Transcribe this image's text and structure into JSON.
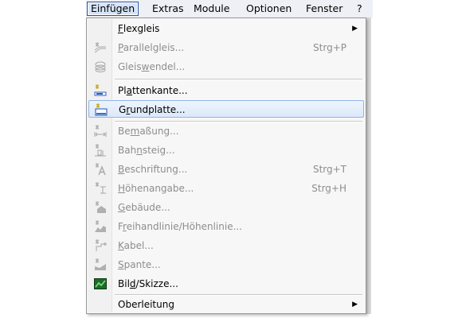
{
  "menubar": {
    "items": [
      {
        "label": "Einfügen",
        "active": true
      },
      {
        "label": "Extras"
      },
      {
        "label": "Module"
      },
      {
        "label": "Optionen"
      },
      {
        "label": "Fenster"
      },
      {
        "label": "?"
      }
    ]
  },
  "menu": {
    "items": [
      {
        "pre": "",
        "u": "F",
        "post": "lexgleis",
        "shortcut": "",
        "submenu": true,
        "enabled": true,
        "icon": "none"
      },
      {
        "pre": "",
        "u": "P",
        "post": "arallelgleis...",
        "shortcut": "Strg+P",
        "enabled": false,
        "icon": "parallel-track-icon"
      },
      {
        "pre": "Gleis",
        "u": "w",
        "post": "endel...",
        "shortcut": "",
        "enabled": false,
        "icon": "helix-icon"
      },
      {
        "pre": "Pl",
        "u": "a",
        "post": "ttenkante...",
        "shortcut": "",
        "enabled": true,
        "icon": "plate-edge-icon"
      },
      {
        "pre": "G",
        "u": "r",
        "post": "undplatte...",
        "shortcut": "",
        "enabled": true,
        "selected": true,
        "icon": "baseplate-icon"
      },
      {
        "pre": "Be",
        "u": "m",
        "post": "aßung...",
        "shortcut": "",
        "enabled": false,
        "icon": "dimension-icon"
      },
      {
        "pre": "Bah",
        "u": "n",
        "post": "steig...",
        "shortcut": "",
        "enabled": false,
        "icon": "platform-icon"
      },
      {
        "pre": "",
        "u": "B",
        "post": "eschriftung...",
        "shortcut": "Strg+T",
        "enabled": false,
        "icon": "text-label-icon"
      },
      {
        "pre": "",
        "u": "H",
        "post": "öhenangabe...",
        "shortcut": "Strg+H",
        "enabled": false,
        "icon": "height-marker-icon"
      },
      {
        "pre": "",
        "u": "G",
        "post": "ebäude...",
        "shortcut": "",
        "enabled": false,
        "icon": "building-icon"
      },
      {
        "pre": "F",
        "u": "r",
        "post": "eihandlinie/Höhenlinie...",
        "shortcut": "",
        "enabled": false,
        "icon": "freehand-line-icon"
      },
      {
        "pre": "",
        "u": "K",
        "post": "abel...",
        "shortcut": "",
        "enabled": false,
        "icon": "cable-icon"
      },
      {
        "pre": "",
        "u": "S",
        "post": "pante...",
        "shortcut": "",
        "enabled": false,
        "icon": "frame-icon"
      },
      {
        "pre": "Bil",
        "u": "d",
        "post": "/Skizze...",
        "shortcut": "",
        "enabled": true,
        "icon": "image-sketch-icon"
      },
      {
        "pre": "Oberleitung",
        "u": "",
        "post": "",
        "shortcut": "",
        "submenu": true,
        "enabled": true,
        "icon": "none"
      }
    ]
  }
}
